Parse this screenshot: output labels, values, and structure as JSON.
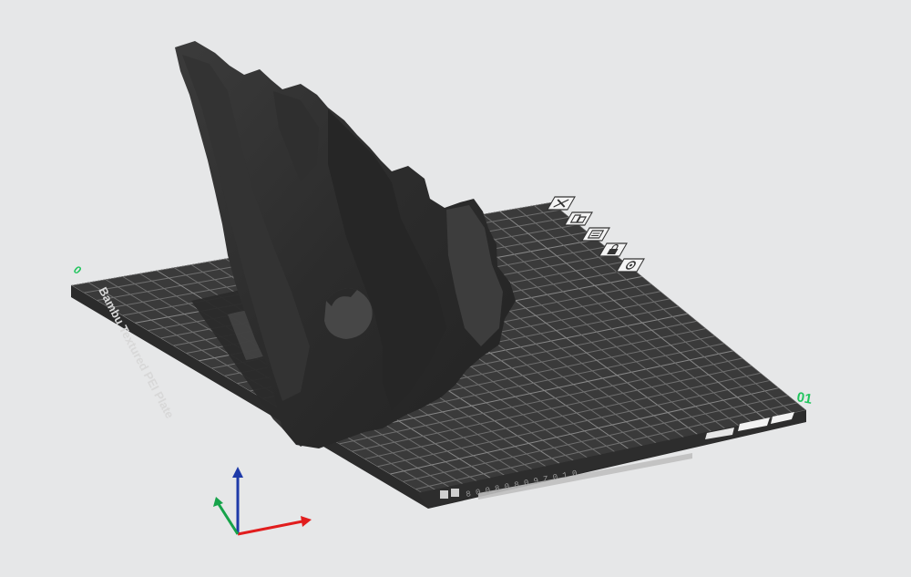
{
  "viewport": {
    "background": "#e6e7e8"
  },
  "plate": {
    "name": "Bambu Textured PEI Plate",
    "plate_number": "01",
    "corner_mark": "0",
    "surface_color": "#3a3a3a",
    "grid_color": "#6f6f6f",
    "border_color": "#2b2b2b",
    "label_color": "#d8d8d8",
    "number_color": "#22c55e",
    "front_strip_text": "8 0 0 8 0 8 0 9 Z 0 1 0"
  },
  "plate_toolbar": {
    "items": [
      {
        "icon": "close-icon",
        "tooltip": ""
      },
      {
        "icon": "arrange-icon",
        "tooltip": ""
      },
      {
        "icon": "orient-icon",
        "tooltip": ""
      },
      {
        "icon": "lock-icon",
        "tooltip": ""
      },
      {
        "icon": "settings-icon",
        "tooltip": ""
      }
    ]
  },
  "model": {
    "name": "",
    "color": "#2e2e2e"
  },
  "axes": {
    "x_color": "#e11d1d",
    "y_color": "#16a34a",
    "z_color": "#1e3aa8"
  }
}
